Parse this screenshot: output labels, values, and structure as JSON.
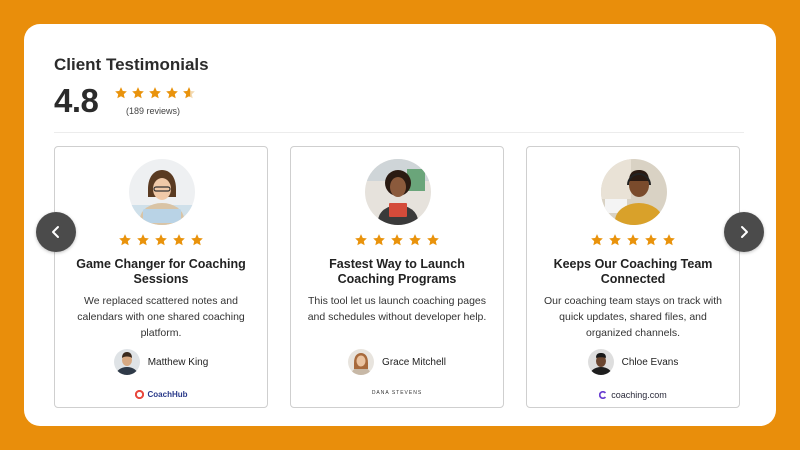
{
  "header": {
    "title": "Client Testimonials",
    "rating": "4.8",
    "reviews": "(189 reviews)",
    "star_fraction": 0.8
  },
  "colors": {
    "accent": "#E98E0B",
    "star": "#E9930C"
  },
  "nav": {
    "prev_icon": "chevron-left-icon",
    "next_icon": "chevron-right-icon"
  },
  "testimonials": [
    {
      "title": "Game Changer for Coaching Sessions",
      "body": "We replaced scattered notes and calendars with one shared coaching platform.",
      "author": "Matthew King",
      "logo": "CoachHub",
      "stars": 5
    },
    {
      "title": "Fastest Way to Launch Coaching Programs",
      "body": "This tool let us launch coaching pages and schedules without developer help.",
      "author": "Grace Mitchell",
      "logo": "DANA STEVENS",
      "stars": 5
    },
    {
      "title": "Keeps Our Coaching Team Connected",
      "body": "Our coaching team stays on track with quick updates, shared files, and organized channels.",
      "author": "Chloe Evans",
      "logo": "coaching.com",
      "stars": 5
    }
  ]
}
